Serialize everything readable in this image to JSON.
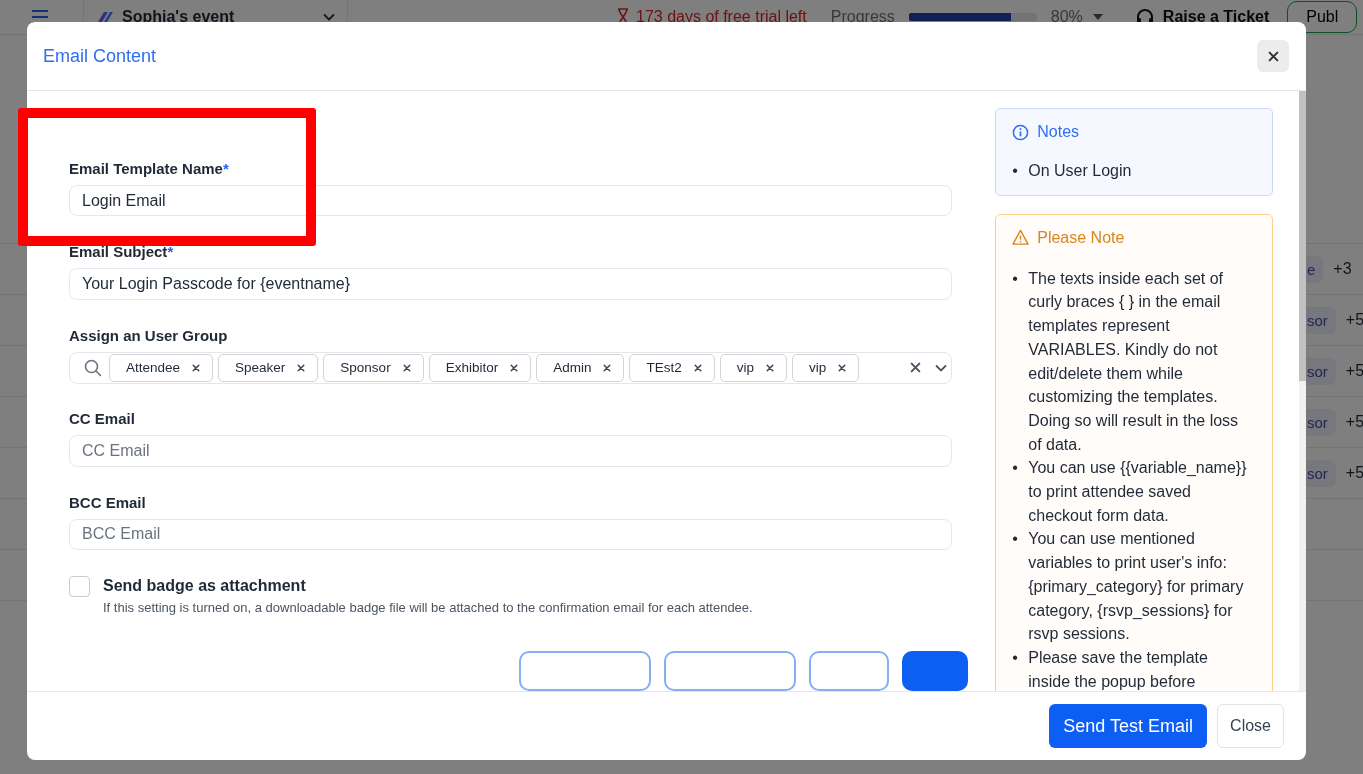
{
  "topbar": {
    "event_name": "Sophia's event",
    "trial_notice": "173 days of free trial left",
    "progress_label": "Progress",
    "progress": {
      "level": 0.8
    },
    "progress_value": "80%",
    "ticket_button": "Raise a Ticket",
    "publish_button": "Publ"
  },
  "background_rows": [
    {
      "tag": "e",
      "count": "+3"
    },
    {
      "tag": "sor",
      "count": "+5"
    },
    {
      "tag": "sor",
      "count": "+5"
    },
    {
      "tag": "sor",
      "count": "+5"
    },
    {
      "tag": "sor",
      "count": "+5"
    }
  ],
  "modal": {
    "title": "Email Content",
    "fields": [
      {
        "kind": "text",
        "label": "Email Template Name",
        "required_mark": "*",
        "value": "Login Email"
      },
      {
        "kind": "text",
        "label": "Email Subject",
        "required_mark": "*",
        "value": "Your Login Passcode for {eventname}"
      },
      {
        "kind": "tags",
        "label": "Assign an User Group",
        "tags": [
          "Attendee",
          "Speaker",
          "Sponsor",
          "Exhibitor",
          "Admin",
          "TEst2",
          "vip",
          "vip"
        ]
      },
      {
        "kind": "text",
        "label": "CC Email",
        "placeholder": "CC Email"
      },
      {
        "kind": "text",
        "label": "BCC Email",
        "placeholder": "BCC Email"
      }
    ],
    "badge_option": {
      "label": "Send badge as attachment",
      "checked": false,
      "help": "If this setting is turned on, a downloadable badge file will be attached to the confirmation email for each attendee."
    },
    "partial_buttons": [
      {
        "kind": "outline"
      },
      {
        "kind": "outline"
      },
      {
        "kind": "outline"
      },
      {
        "kind": "primary"
      }
    ],
    "bullet": "•",
    "notes": {
      "title": "Notes",
      "items": [
        "On User Login"
      ]
    },
    "please_note": {
      "title": "Please Note",
      "items": [
        "The texts inside each set of curly braces { } in the email templates represent VARIABLES. Kindly do not edit/delete them while customizing the templates. Doing so will result in the loss of data.",
        "You can use {{variable_name}} to print attendee saved checkout form data.",
        "You can use mentioned variables to print user's info: {primary_category} for primary category, {rsvp_sessions} for rsvp sessions.",
        "Please save the template inside the popup before"
      ]
    },
    "footer_buttons": [
      {
        "label": "Send Test Email",
        "kind": "primary"
      },
      {
        "label": "Close",
        "kind": "secondary"
      }
    ]
  },
  "annotation": {
    "kind": "rectangle"
  }
}
